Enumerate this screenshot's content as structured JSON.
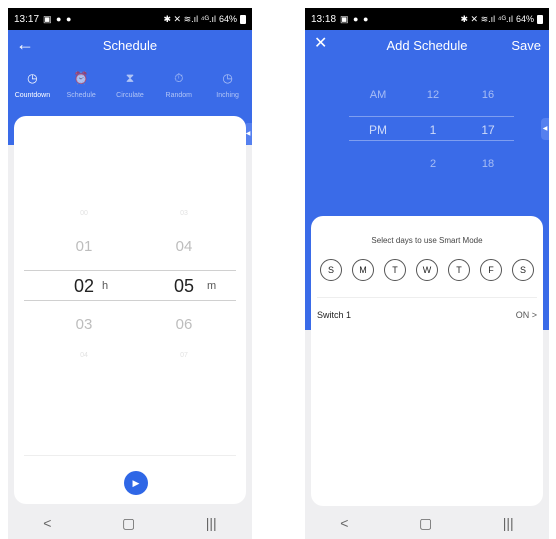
{
  "left": {
    "status": {
      "time": "13:17",
      "icons": "▣ ● ●",
      "right": "✱ ✕ ≋.ıl ⁴ᴳ.ıl",
      "battery": "64%"
    },
    "header": {
      "back": "←",
      "title": "Schedule"
    },
    "tabs": [
      {
        "label": "Countdown",
        "icon": "◷",
        "icon_name": "clock-icon"
      },
      {
        "label": "Schedule",
        "icon": "⏰",
        "icon_name": "alarm-icon"
      },
      {
        "label": "Circulate",
        "icon": "⧗",
        "icon_name": "hourglass-icon"
      },
      {
        "label": "Random",
        "icon": "⏱",
        "icon_name": "stopwatch-icon"
      },
      {
        "label": "Inching",
        "icon": "◷",
        "icon_name": "clock-icon"
      }
    ],
    "picker": {
      "hours": [
        "00",
        "01",
        "02",
        "03",
        "04"
      ],
      "minutes": [
        "03",
        "04",
        "05",
        "06",
        "07"
      ],
      "hour_unit": "h",
      "minute_unit": "m"
    },
    "play": "▶"
  },
  "right": {
    "status": {
      "time": "13:18",
      "icons": "▣ ● ●",
      "right": "✱ ✕ ≋.ıl ⁴ᴳ.ıl",
      "battery": "64%"
    },
    "header": {
      "close": "✕",
      "title": "Add Schedule",
      "save": "Save"
    },
    "time_picker": {
      "ampm": [
        "AM",
        "PM"
      ],
      "hours": [
        "12",
        "1",
        "2"
      ],
      "minutes": [
        "16",
        "17",
        "18"
      ]
    },
    "days_title": "Select days to use Smart Mode",
    "days": [
      "S",
      "M",
      "T",
      "W",
      "T",
      "F",
      "S"
    ],
    "switch": {
      "name": "Switch 1",
      "value": "ON",
      "chevron": ">"
    }
  },
  "nav": {
    "back": "<",
    "home": "▢",
    "recent": "|||"
  },
  "colors": {
    "primary": "#3a6be8",
    "background": "#efeff1",
    "card": "#ffffff"
  }
}
